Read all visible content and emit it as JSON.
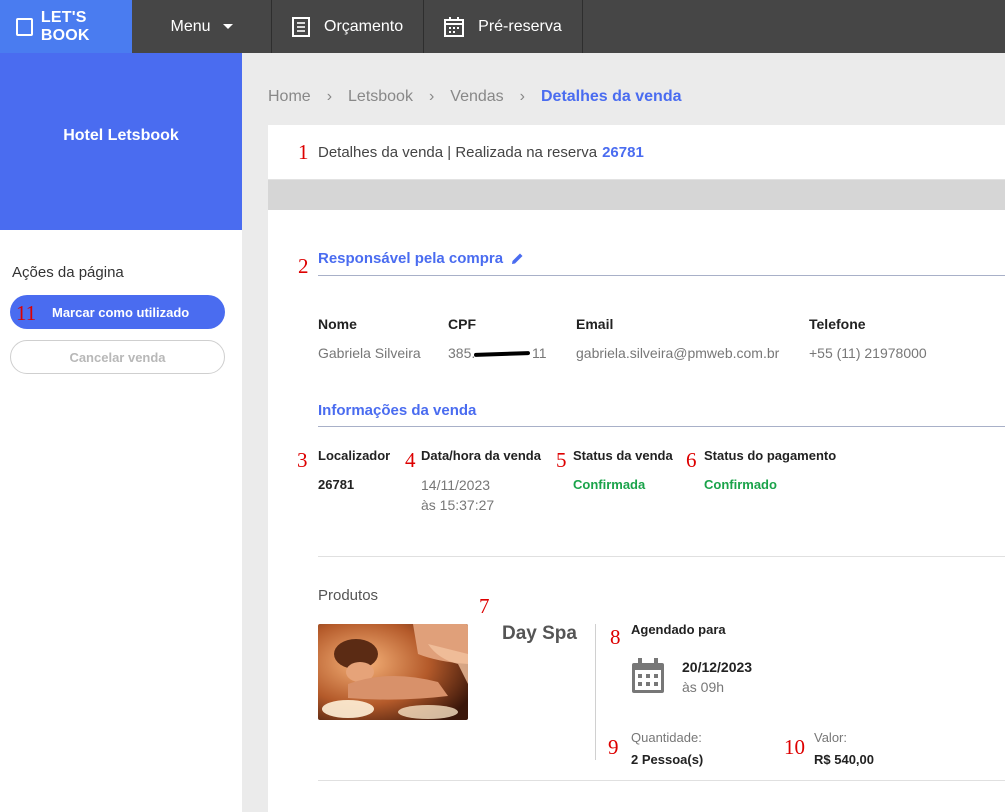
{
  "topbar": {
    "logo": "LET'S BOOK",
    "menu": "Menu",
    "orcamento": "Orçamento",
    "prereserva": "Pré-reserva"
  },
  "sidebar": {
    "hotel": "Hotel Letsbook",
    "actions_title": "Ações da página",
    "mark_used": "Marcar como utilizado",
    "cancel": "Cancelar venda"
  },
  "breadcrumb": [
    "Home",
    "Letsbook",
    "Vendas",
    "Detalhes da venda"
  ],
  "header": {
    "text": "Detalhes da venda | Realizada na reserva",
    "reservation": "26781"
  },
  "buyer": {
    "title": "Responsável pela compra",
    "labels": {
      "name": "Nome",
      "cpf": "CPF",
      "email": "Email",
      "phone": "Telefone"
    },
    "name": "Gabriela Silveira",
    "cpf_start": "385.",
    "cpf_end": "11",
    "email": "gabriela.silveira@pmweb.com.br",
    "phone": "+55 (11) 21978000"
  },
  "sale": {
    "title": "Informações da venda",
    "labels": {
      "locator": "Localizador",
      "datetime": "Data/hora da venda",
      "status": "Status da venda",
      "payment": "Status do pagamento"
    },
    "locator": "26781",
    "date": "14/11/2023",
    "time": "às 15:37:27",
    "status": "Confirmada",
    "payment": "Confirmado"
  },
  "products": {
    "title": "Produtos",
    "name": "Day Spa",
    "scheduled_label": "Agendado para",
    "date": "20/12/2023",
    "time": "às 09h",
    "qty_label": "Quantidade:",
    "qty": "2 Pessoa(s)",
    "value_label": "Valor:",
    "value": "R$ 540,00"
  },
  "annotations": [
    "1",
    "2",
    "3",
    "4",
    "5",
    "6",
    "7",
    "8",
    "9",
    "10",
    "11"
  ],
  "colors": {
    "accent": "#4a6cf0",
    "topbar": "#464646",
    "green": "#1aa34a",
    "annotation": "#dd0000"
  }
}
